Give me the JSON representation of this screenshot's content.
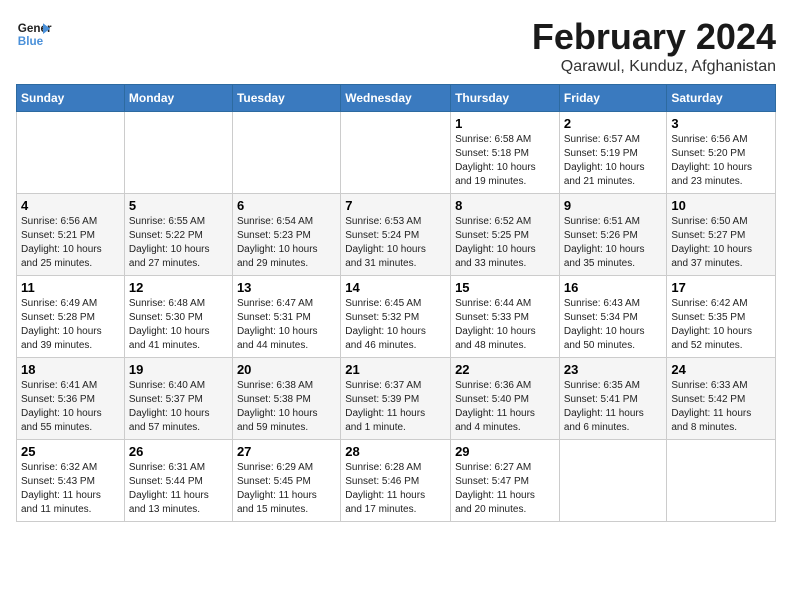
{
  "logo": {
    "line1": "General",
    "line2": "Blue"
  },
  "title": "February 2024",
  "subtitle": "Qarawul, Kunduz, Afghanistan",
  "days_header": [
    "Sunday",
    "Monday",
    "Tuesday",
    "Wednesday",
    "Thursday",
    "Friday",
    "Saturday"
  ],
  "weeks": [
    [
      {
        "day": "",
        "info": ""
      },
      {
        "day": "",
        "info": ""
      },
      {
        "day": "",
        "info": ""
      },
      {
        "day": "",
        "info": ""
      },
      {
        "day": "1",
        "info": "Sunrise: 6:58 AM\nSunset: 5:18 PM\nDaylight: 10 hours\nand 19 minutes."
      },
      {
        "day": "2",
        "info": "Sunrise: 6:57 AM\nSunset: 5:19 PM\nDaylight: 10 hours\nand 21 minutes."
      },
      {
        "day": "3",
        "info": "Sunrise: 6:56 AM\nSunset: 5:20 PM\nDaylight: 10 hours\nand 23 minutes."
      }
    ],
    [
      {
        "day": "4",
        "info": "Sunrise: 6:56 AM\nSunset: 5:21 PM\nDaylight: 10 hours\nand 25 minutes."
      },
      {
        "day": "5",
        "info": "Sunrise: 6:55 AM\nSunset: 5:22 PM\nDaylight: 10 hours\nand 27 minutes."
      },
      {
        "day": "6",
        "info": "Sunrise: 6:54 AM\nSunset: 5:23 PM\nDaylight: 10 hours\nand 29 minutes."
      },
      {
        "day": "7",
        "info": "Sunrise: 6:53 AM\nSunset: 5:24 PM\nDaylight: 10 hours\nand 31 minutes."
      },
      {
        "day": "8",
        "info": "Sunrise: 6:52 AM\nSunset: 5:25 PM\nDaylight: 10 hours\nand 33 minutes."
      },
      {
        "day": "9",
        "info": "Sunrise: 6:51 AM\nSunset: 5:26 PM\nDaylight: 10 hours\nand 35 minutes."
      },
      {
        "day": "10",
        "info": "Sunrise: 6:50 AM\nSunset: 5:27 PM\nDaylight: 10 hours\nand 37 minutes."
      }
    ],
    [
      {
        "day": "11",
        "info": "Sunrise: 6:49 AM\nSunset: 5:28 PM\nDaylight: 10 hours\nand 39 minutes."
      },
      {
        "day": "12",
        "info": "Sunrise: 6:48 AM\nSunset: 5:30 PM\nDaylight: 10 hours\nand 41 minutes."
      },
      {
        "day": "13",
        "info": "Sunrise: 6:47 AM\nSunset: 5:31 PM\nDaylight: 10 hours\nand 44 minutes."
      },
      {
        "day": "14",
        "info": "Sunrise: 6:45 AM\nSunset: 5:32 PM\nDaylight: 10 hours\nand 46 minutes."
      },
      {
        "day": "15",
        "info": "Sunrise: 6:44 AM\nSunset: 5:33 PM\nDaylight: 10 hours\nand 48 minutes."
      },
      {
        "day": "16",
        "info": "Sunrise: 6:43 AM\nSunset: 5:34 PM\nDaylight: 10 hours\nand 50 minutes."
      },
      {
        "day": "17",
        "info": "Sunrise: 6:42 AM\nSunset: 5:35 PM\nDaylight: 10 hours\nand 52 minutes."
      }
    ],
    [
      {
        "day": "18",
        "info": "Sunrise: 6:41 AM\nSunset: 5:36 PM\nDaylight: 10 hours\nand 55 minutes."
      },
      {
        "day": "19",
        "info": "Sunrise: 6:40 AM\nSunset: 5:37 PM\nDaylight: 10 hours\nand 57 minutes."
      },
      {
        "day": "20",
        "info": "Sunrise: 6:38 AM\nSunset: 5:38 PM\nDaylight: 10 hours\nand 59 minutes."
      },
      {
        "day": "21",
        "info": "Sunrise: 6:37 AM\nSunset: 5:39 PM\nDaylight: 11 hours\nand 1 minute."
      },
      {
        "day": "22",
        "info": "Sunrise: 6:36 AM\nSunset: 5:40 PM\nDaylight: 11 hours\nand 4 minutes."
      },
      {
        "day": "23",
        "info": "Sunrise: 6:35 AM\nSunset: 5:41 PM\nDaylight: 11 hours\nand 6 minutes."
      },
      {
        "day": "24",
        "info": "Sunrise: 6:33 AM\nSunset: 5:42 PM\nDaylight: 11 hours\nand 8 minutes."
      }
    ],
    [
      {
        "day": "25",
        "info": "Sunrise: 6:32 AM\nSunset: 5:43 PM\nDaylight: 11 hours\nand 11 minutes."
      },
      {
        "day": "26",
        "info": "Sunrise: 6:31 AM\nSunset: 5:44 PM\nDaylight: 11 hours\nand 13 minutes."
      },
      {
        "day": "27",
        "info": "Sunrise: 6:29 AM\nSunset: 5:45 PM\nDaylight: 11 hours\nand 15 minutes."
      },
      {
        "day": "28",
        "info": "Sunrise: 6:28 AM\nSunset: 5:46 PM\nDaylight: 11 hours\nand 17 minutes."
      },
      {
        "day": "29",
        "info": "Sunrise: 6:27 AM\nSunset: 5:47 PM\nDaylight: 11 hours\nand 20 minutes."
      },
      {
        "day": "",
        "info": ""
      },
      {
        "day": "",
        "info": ""
      }
    ]
  ]
}
